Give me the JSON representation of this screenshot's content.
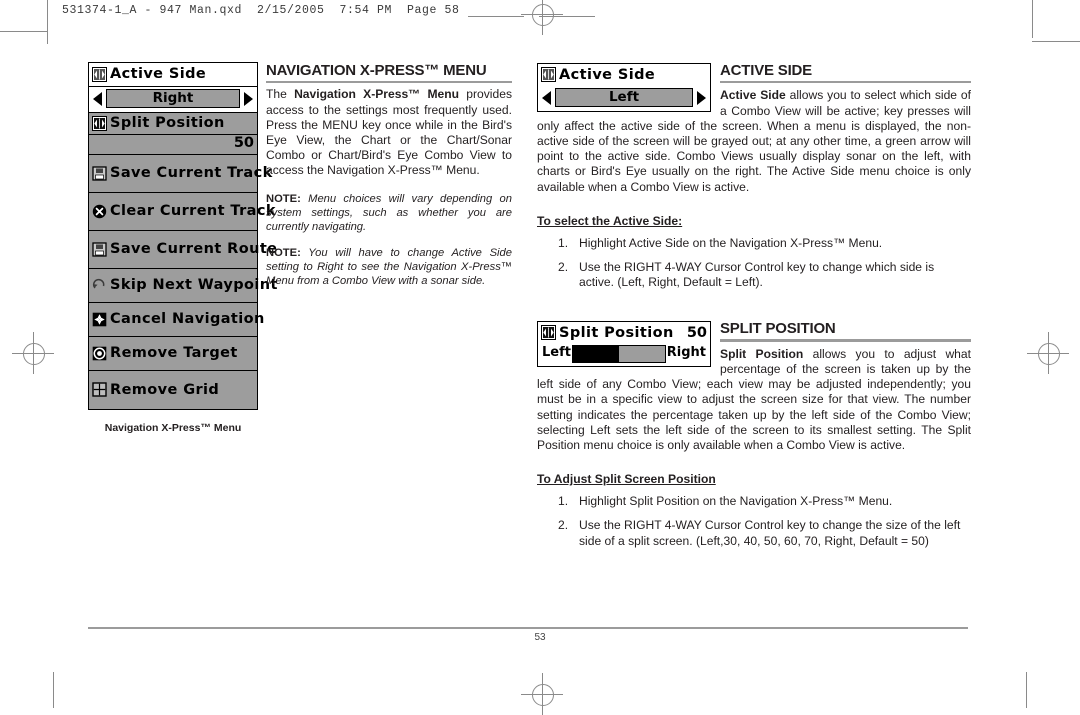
{
  "slug": "531374-1_A - 947 Man.qxd  2/15/2005  7:54 PM  Page 58",
  "folio": "53",
  "left_panel": {
    "caption": "Navigation X-Press™ Menu",
    "rows": [
      {
        "icon": "left-right-selector-icon",
        "label": "Active Side",
        "type": "selector",
        "value": "Right",
        "bg": "white"
      },
      {
        "icon": "left-right-selector-icon",
        "label": "Split Position",
        "type": "number",
        "value": "50",
        "bg": "gray"
      },
      {
        "icon": "save-disk-icon",
        "label": "Save Current Track",
        "type": "plain",
        "bg": "gray"
      },
      {
        "icon": "clear-x-icon",
        "label": "Clear Current Track",
        "type": "plain",
        "bg": "gray"
      },
      {
        "icon": "save-disk-icon",
        "label": "Save Current Route",
        "type": "plain",
        "bg": "gray"
      },
      {
        "icon": "skip-waypoint-icon",
        "label": "Skip Next Waypoint",
        "type": "plain",
        "bg": "gray"
      },
      {
        "icon": "cancel-navigation-icon",
        "label": "Cancel Navigation",
        "type": "plain",
        "bg": "gray"
      },
      {
        "icon": "remove-target-icon",
        "label": "Remove Target",
        "type": "plain",
        "bg": "gray"
      },
      {
        "icon": "remove-grid-icon",
        "label": "Remove Grid",
        "type": "plain",
        "bg": "gray"
      }
    ]
  },
  "mid_column": {
    "heading": "NAVIGATION X-PRESS™ MENU",
    "intro_prefix": "The ",
    "intro_bold": "Navigation X-Press™ Menu",
    "intro_rest": " provides access to the settings most frequently used. Press the MENU key once while in the Bird's Eye View, the Chart or the Chart/Sonar Combo or Chart/Bird's Eye Combo View to access the Navigation X-Press™ Menu.",
    "note1_label": "NOTE:",
    "note1_text": " Menu choices will vary depending on system settings, such as whether you are currently navigating.",
    "note2_label": "NOTE:",
    "note2_text": " You will have to change Active Side setting to Right to see the Navigation X-Press™ Menu from a Combo View with a sonar side."
  },
  "active_side": {
    "widget": {
      "icon": "left-right-selector-icon",
      "label": "Active Side",
      "value": "Left"
    },
    "heading": "ACTIVE SIDE",
    "body_bold": "Active Side",
    "body_text": " allows you to select which side of a Combo View will be active; key presses will only affect the active side of the screen. When a menu is displayed, the non-active side of the screen will be grayed out; at any other time, a green arrow will point to the active side. Combo Views usually display sonar on the left, with charts or Bird's Eye usually on the right. The Active Side menu choice is only available when a Combo View is active.",
    "sub_head": "To select the Active Side:",
    "steps": [
      "Highlight Active Side on the Navigation X-Press™ Menu.",
      "Use the RIGHT 4-WAY Cursor Control key to change which side is active. (Left, Right, Default = Left)."
    ]
  },
  "split_position": {
    "widget": {
      "icon": "left-right-selector-icon",
      "label": "Split Position",
      "value": "50",
      "left_label": "Left",
      "right_label": "Right",
      "fill_percent": 50
    },
    "heading": "SPLIT POSITION",
    "body_bold": "Split Position",
    "body_text": " allows you to adjust what percentage of the screen is taken up by the left side of any Combo View; each view may be adjusted independently; you must be in a specific view to adjust the screen size for that view. The number setting indicates the percentage taken up by the left side of the Combo View; selecting Left sets the left side of the screen to its smallest setting. The Split Position menu choice is only available when a Combo View is active.",
    "sub_head": "To Adjust Split Screen Position",
    "steps": [
      "Highlight Split Position on the Navigation X-Press™ Menu.",
      "Use the RIGHT 4-WAY Cursor Control key to change the size of the left side of a split screen. (Left,30, 40, 50, 60, 70, Right, Default = 50)"
    ]
  },
  "colors": {
    "lcd_gray": "#9d9d9d",
    "rule_gray": "#9b9b9b",
    "ink": "#231f20"
  }
}
